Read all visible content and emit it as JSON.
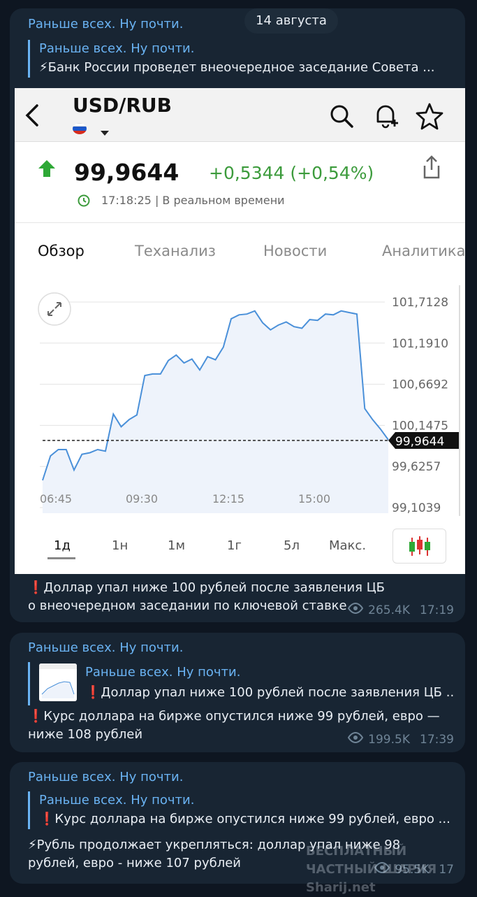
{
  "date_pill": "14 августа",
  "msg1": {
    "sender": "Раньше всех. Ну почти.",
    "reply_name": "Раньше всех. Ну почти.",
    "reply_text": "⚡Банк России проведет внеочередное заседание Совета ...",
    "text": "❗Доллар упал ниже 100 рублей после заявления ЦБ о внеочередном заседании по ключевой ставке",
    "views": "265.4K",
    "time": "17:19"
  },
  "shot": {
    "pair": "USD/RUB",
    "price": "99,9644",
    "change": "+0,5344 (+0,54%)",
    "timestamp": "17:18:25 | В реальном времени",
    "tabs": [
      "Обзор",
      "Теханализ",
      "Новости",
      "Аналитика"
    ],
    "periods": [
      "1д",
      "1н",
      "1м",
      "1г",
      "5л",
      "Макс."
    ],
    "current_label": "99,9644",
    "colors": {
      "up": "#3c9b3c",
      "line": "#4a90d9",
      "area": "#eef3fb"
    }
  },
  "chart_data": {
    "type": "area",
    "x_ticks": [
      "06:45",
      "09:30",
      "12:15",
      "15:00"
    ],
    "y_ticks": [
      "101,7128",
      "101,1910",
      "100,6692",
      "100,1475",
      "99,6257",
      "99,1039"
    ],
    "ylim": [
      99.1039,
      101.7128
    ],
    "current_value": 99.9644,
    "x": [
      0,
      2,
      4,
      6,
      8,
      10,
      12,
      14,
      16,
      18,
      20,
      22,
      24,
      26,
      28,
      30,
      32,
      34,
      36,
      38,
      40,
      42,
      44,
      46,
      48,
      50,
      52,
      54,
      56,
      58,
      60,
      62,
      64,
      66,
      68,
      70,
      72,
      74,
      76,
      78,
      80,
      82,
      84,
      86,
      88,
      90,
      92,
      94,
      96,
      98,
      100
    ],
    "values": [
      99.45,
      99.76,
      99.84,
      99.84,
      99.58,
      99.78,
      99.8,
      99.84,
      99.82,
      100.29,
      100.13,
      100.22,
      100.28,
      100.78,
      100.8,
      100.8,
      100.97,
      101.04,
      100.94,
      100.99,
      100.85,
      101.02,
      100.98,
      101.14,
      101.5,
      101.55,
      101.56,
      101.6,
      101.45,
      101.36,
      101.42,
      101.46,
      101.4,
      101.38,
      101.49,
      101.48,
      101.56,
      101.55,
      101.6,
      101.58,
      101.56,
      100.36,
      100.22,
      100.1,
      99.9644,
      99.9644,
      99.9644,
      99.9644,
      99.9644,
      99.9644,
      99.9644
    ]
  },
  "msg2": {
    "sender": "Раньше всех. Ну почти.",
    "reply_name": "Раньше всех. Ну почти.",
    "reply_text": "❗Доллар упал ниже 100 рублей после заявления ЦБ ...",
    "text": "❗Курс доллара на бирже опустился ниже 99 рублей, евро — ниже 108 рублей",
    "views": "199.5K",
    "time": "17:39"
  },
  "msg3": {
    "sender": "Раньше всех. Ну почти.",
    "reply_name": "Раньше всех. Ну почти.",
    "reply_text": "❗Курс доллара на бирже опустился ниже 99 рублей, евро ...",
    "text": "⚡Рубль продолжает укрепляться: доллар упал ниже 98 рублей, евро - ниже 107 рублей",
    "views": "95.5K",
    "time": "17"
  },
  "watermark": "БЕСПЛАТНЫЙ ЧАСТНЫЙ ШАРИЯ Sharij.net"
}
